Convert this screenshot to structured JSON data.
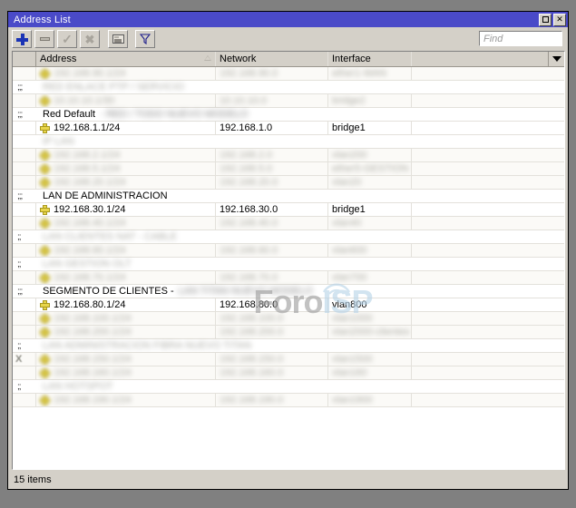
{
  "window": {
    "title": "Address List",
    "buttons": {
      "maximize": "maximize-restore",
      "close": "✕"
    }
  },
  "toolbar": {
    "add": "+",
    "remove": "−",
    "enable": "✓",
    "disable": "✕",
    "comment": "comment",
    "filter": "filter",
    "find_placeholder": "Find"
  },
  "table": {
    "columns": [
      {
        "key": "flags",
        "label": ""
      },
      {
        "key": "address",
        "label": "Address",
        "sorted": "asc"
      },
      {
        "key": "network",
        "label": "Network"
      },
      {
        "key": "interface",
        "label": "Interface"
      },
      {
        "key": "extra",
        "label": ""
      }
    ],
    "rows": [
      {
        "type": "address",
        "flags": "",
        "address": "192.168.90.1/24",
        "network": "192.168.90.0",
        "interface": "ether1-WAN",
        "redacted": true,
        "selected": true
      },
      {
        "type": "comment",
        "flags": ";;;",
        "text": "RED ENLACE PTP / SERVICIO",
        "redacted": true
      },
      {
        "type": "address",
        "flags": "",
        "address": "10.10.10.1/30",
        "network": "10.10.10.0",
        "interface": "bridge2",
        "redacted": true
      },
      {
        "type": "comment",
        "flags": ";;;",
        "text": "Red Default",
        "suffix": "- RED / TODO NUEVO MODELO",
        "suffix_redacted": true,
        "redacted": false
      },
      {
        "type": "address",
        "flags": "",
        "address": "192.168.1.1/24",
        "network": "192.168.1.0",
        "interface": "bridge1",
        "redacted": false
      },
      {
        "type": "comment",
        "flags": "",
        "text": "IP LAN",
        "redacted": true
      },
      {
        "type": "address",
        "flags": "",
        "address": "192.168.2.1/24",
        "network": "192.168.2.0",
        "interface": "vlan200",
        "redacted": true
      },
      {
        "type": "address",
        "flags": "",
        "address": "192.168.5.1/24",
        "network": "192.168.5.0",
        "interface": "ether5-GESTION",
        "redacted": true
      },
      {
        "type": "address",
        "flags": "",
        "address": "192.168.20.1/24",
        "network": "192.168.20.0",
        "interface": "vlan20",
        "redacted": true
      },
      {
        "type": "comment",
        "flags": ";;;",
        "text": "LAN DE ADMINISTRACION",
        "redacted": false
      },
      {
        "type": "address",
        "flags": "",
        "address": "192.168.30.1/24",
        "network": "192.168.30.0",
        "interface": "bridge1",
        "redacted": false
      },
      {
        "type": "address",
        "flags": "",
        "address": "192.168.40.1/24",
        "network": "192.168.40.0",
        "interface": "vlan40",
        "redacted": true
      },
      {
        "type": "comment",
        "flags": ";;",
        "text": "LAN CLIENTES NAT - CABLE",
        "redacted": true
      },
      {
        "type": "address",
        "flags": "",
        "address": "192.168.60.1/24",
        "network": "192.168.60.0",
        "interface": "vlan600",
        "redacted": true
      },
      {
        "type": "comment",
        "flags": ";;",
        "text": "LAN GESTION OLT",
        "redacted": true
      },
      {
        "type": "address",
        "flags": "",
        "address": "192.168.70.1/24",
        "network": "192.168.70.0",
        "interface": "vlan700",
        "redacted": true
      },
      {
        "type": "comment",
        "flags": ";;;",
        "text": "SEGMENTO DE CLIENTES -",
        "suffix": "LAN TITAN NUEVO MODELO",
        "suffix_redacted": true,
        "redacted": false
      },
      {
        "type": "address",
        "flags": "",
        "address": "192.168.80.1/24",
        "network": "192.168.80.0",
        "interface": "vlan800",
        "redacted": false
      },
      {
        "type": "address",
        "flags": "",
        "address": "192.168.100.1/24",
        "network": "192.168.100.0",
        "interface": "vlan1000",
        "redacted": true
      },
      {
        "type": "address",
        "flags": "",
        "address": "192.168.200.1/24",
        "network": "192.168.200.0",
        "interface": "vlan2000-clientes",
        "redacted": true
      },
      {
        "type": "comment",
        "flags": ";;",
        "text": "LAN ADMINISTRACION FIBRA NUEVO TITAN",
        "redacted": true
      },
      {
        "type": "address",
        "flags": "X",
        "address": "192.168.150.1/24",
        "network": "192.168.150.0",
        "interface": "vlan1500",
        "redacted": true,
        "disabled": true
      },
      {
        "type": "address",
        "flags": "",
        "address": "192.168.160.1/24",
        "network": "192.168.160.0",
        "interface": "vlan160",
        "redacted": true
      },
      {
        "type": "comment",
        "flags": ";;",
        "text": "LAN HOTSPOT",
        "redacted": true
      },
      {
        "type": "address",
        "flags": "",
        "address": "192.168.190.1/24",
        "network": "192.168.190.0",
        "interface": "vlan1900",
        "redacted": true
      }
    ]
  },
  "watermark": {
    "part1": "Foro",
    "part2": "ISP"
  },
  "status": {
    "items_text": "15 items"
  }
}
